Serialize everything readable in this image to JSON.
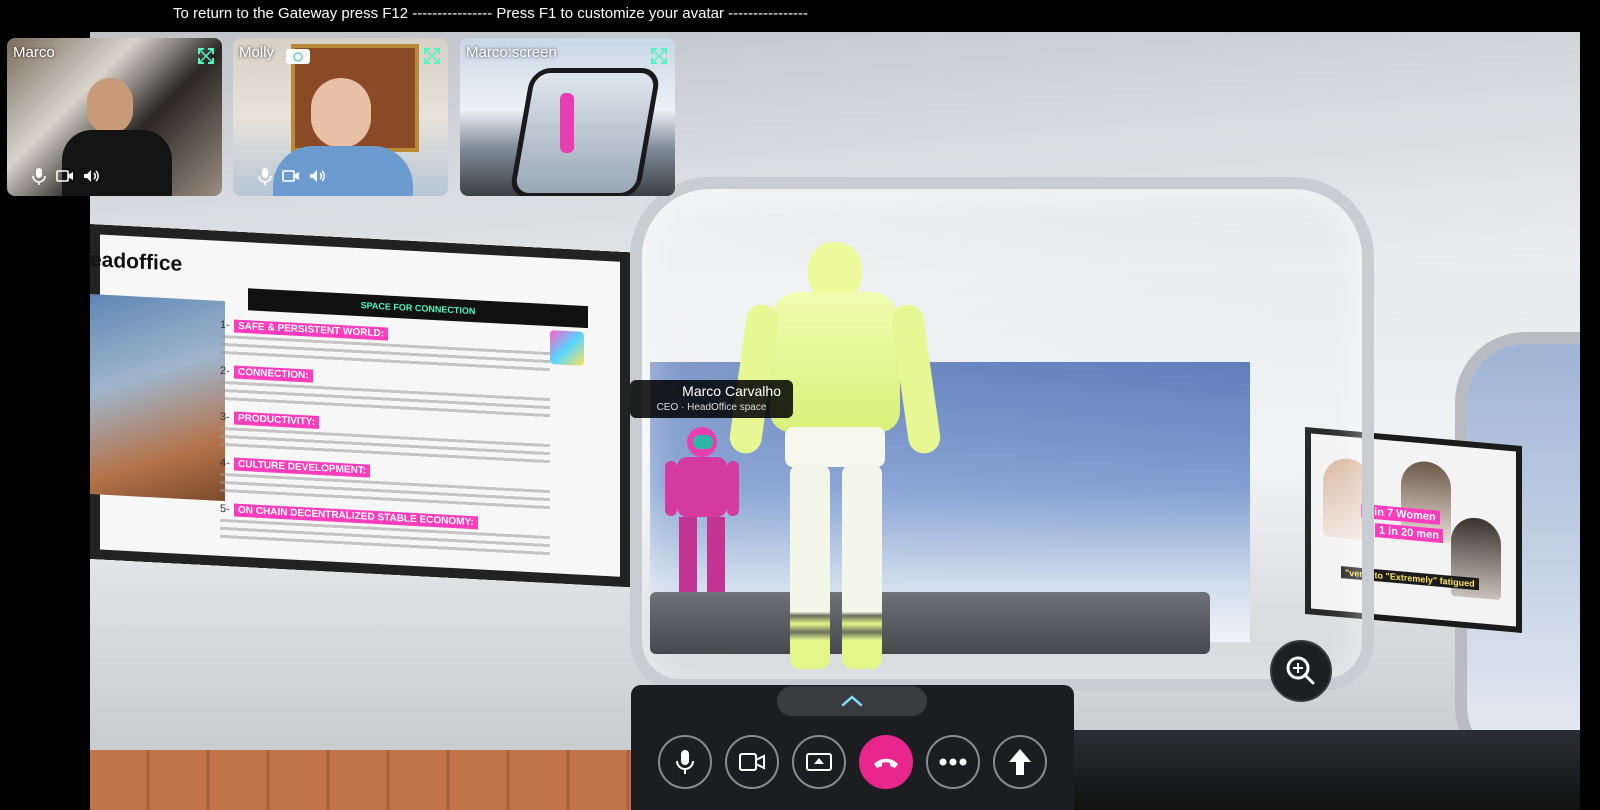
{
  "banner": {
    "text": "To return to the Gateway press F12 ---------------- Press F1 to customize your avatar ----------------"
  },
  "tiles": [
    {
      "name": "Marco"
    },
    {
      "name": "Molly"
    },
    {
      "name": "Marco:screen"
    }
  ],
  "nametag": {
    "name": "Marco Carvalho",
    "role": "CEO · HeadOffice space"
  },
  "slide": {
    "title": "eadoffice",
    "header": "SPACE FOR CONNECTION",
    "items": [
      {
        "num": "1-",
        "label": "SAFE & PERSISTENT WORLD:"
      },
      {
        "num": "2-",
        "label": "CONNECTION:"
      },
      {
        "num": "3-",
        "label": "PRODUCTIVITY:"
      },
      {
        "num": "4-",
        "label": "CULTURE DEVELOPMENT:"
      },
      {
        "num": "5-",
        "label": "ON CHAIN DECENTRALIZED STABLE ECONOMY:"
      }
    ]
  },
  "ad": {
    "line1": "1 in 7 Women",
    "line2": "1 in 20 men",
    "line3": "\"very\" to \"Extremely\" fatigued"
  },
  "colors": {
    "accent": "#e8268d",
    "teal": "#53f5c0",
    "bar": "#1c1d20"
  },
  "icons": {
    "mic": "microphone-icon",
    "camera": "video-camera-icon",
    "share": "screen-share-icon",
    "hangup": "phone-hangup-icon",
    "more": "more-dots-icon",
    "up": "arrow-up-icon",
    "zoom": "zoom-in-icon",
    "expand": "expand-icon"
  }
}
